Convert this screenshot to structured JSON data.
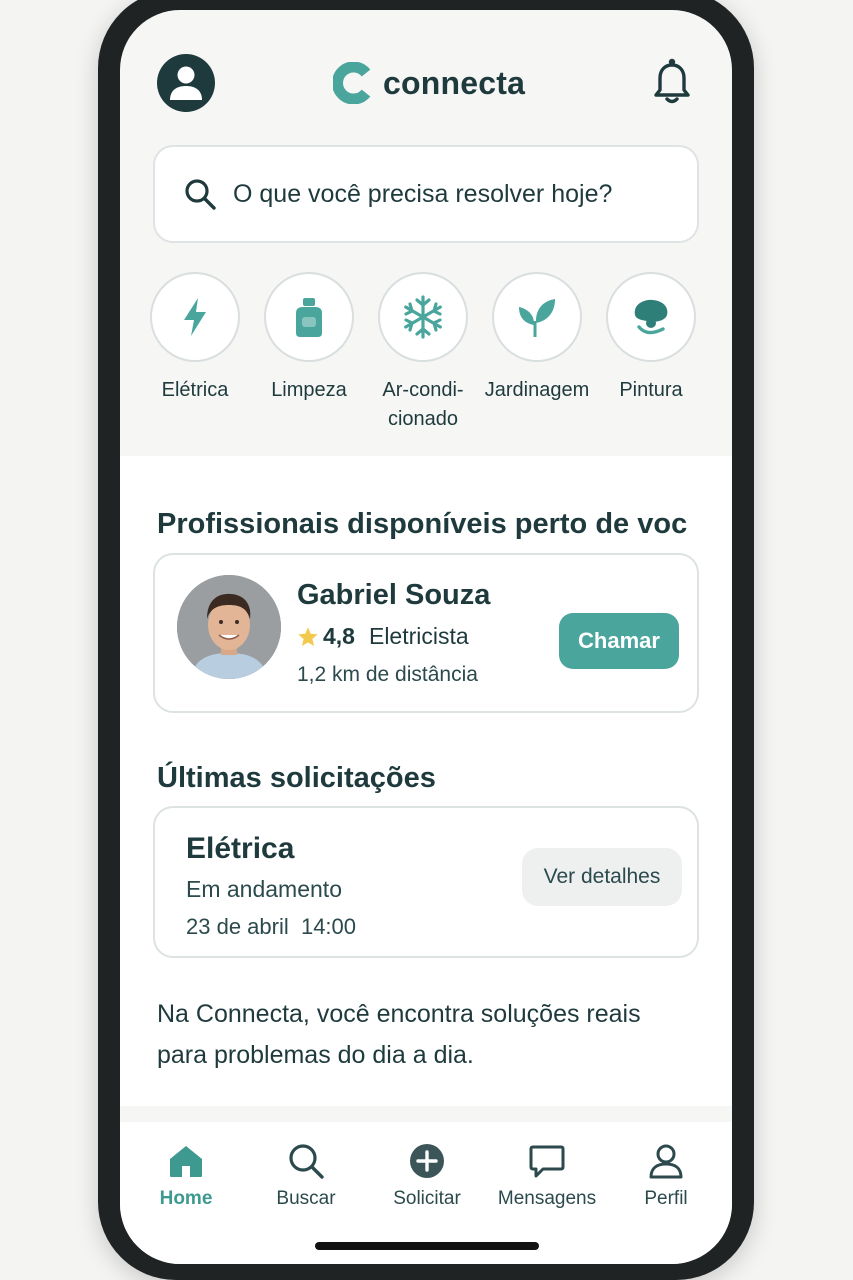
{
  "app": {
    "name": "connecta"
  },
  "colors": {
    "accent": "#4aa69d",
    "text": "#1f3a3d"
  },
  "header": {
    "profile_icon": "user-avatar-icon",
    "notification_icon": "bell-icon"
  },
  "search": {
    "placeholder": "O que você precisa resolver hoje?"
  },
  "categories": [
    {
      "label": "Elétrica",
      "icon": "lightning-icon"
    },
    {
      "label": "Limpeza",
      "icon": "spray-bottle-icon"
    },
    {
      "label": "Ar-condi-\ncionado",
      "icon": "snowflake-icon"
    },
    {
      "label": "Jardinagem",
      "icon": "leaf-icon"
    },
    {
      "label": "Pintura",
      "icon": "paint-icon"
    }
  ],
  "nearby": {
    "title": "Profissionais disponíveis perto de voc",
    "professional": {
      "name": "Gabriel Souza",
      "rating": "4,8",
      "profession": "Eletricista",
      "distance": "1,2 km de distância",
      "action": "Chamar"
    }
  },
  "recent": {
    "title": "Últimas solicitações",
    "request": {
      "category": "Elétrica",
      "status": "Em andamento",
      "date": "23 de abril  14:00",
      "action": "Ver detalhes"
    }
  },
  "tagline": "Na Connecta, você encontra soluções reais para problemas do dia a dia.",
  "nav": [
    {
      "label": "Home",
      "icon": "home-icon",
      "active": true
    },
    {
      "label": "Buscar",
      "icon": "search-icon"
    },
    {
      "label": "Solicitar",
      "icon": "plus-circle-icon"
    },
    {
      "label": "Mensagens",
      "icon": "chat-icon"
    },
    {
      "label": "Perfil",
      "icon": "profile-icon"
    }
  ]
}
